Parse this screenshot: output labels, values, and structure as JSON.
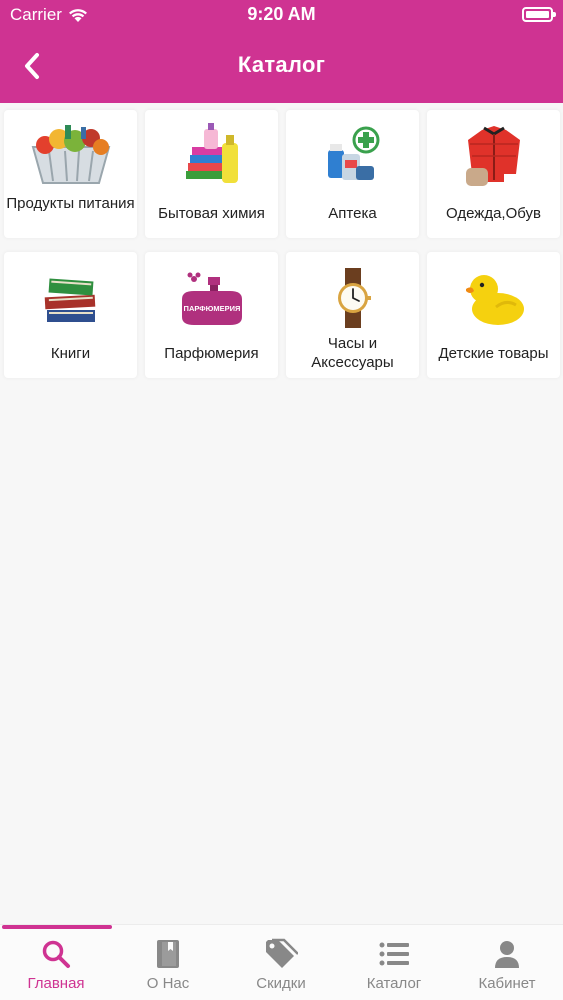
{
  "status_bar": {
    "carrier": "Carrier",
    "time": "9:20 AM"
  },
  "header": {
    "title": "Каталог"
  },
  "colors": {
    "brand": "#cf3392",
    "tab_inactive": "#888888"
  },
  "catalog": [
    {
      "label": "Продукты питания",
      "icon": "grocery-basket-icon"
    },
    {
      "label": "Бытовая химия",
      "icon": "detergent-icon"
    },
    {
      "label": "Аптека",
      "icon": "pharmacy-icon"
    },
    {
      "label": "Одежда,Обув",
      "icon": "clothing-icon"
    },
    {
      "label": "Книги",
      "icon": "books-icon"
    },
    {
      "label": "Парфюмерия",
      "icon": "perfume-icon",
      "icon_text": "ПАРФЮМЕРИЯ"
    },
    {
      "label": "Часы и Аксессуары",
      "icon": "watch-icon"
    },
    {
      "label": "Детские товары",
      "icon": "rubber-duck-icon"
    }
  ],
  "tabbar": [
    {
      "label": "Главная",
      "icon": "search-icon",
      "active": true
    },
    {
      "label": "О Нас",
      "icon": "book-icon",
      "active": false
    },
    {
      "label": "Скидки",
      "icon": "tag-icon",
      "active": false
    },
    {
      "label": "Каталог",
      "icon": "list-icon",
      "active": false
    },
    {
      "label": "Кабинет",
      "icon": "user-icon",
      "active": false
    }
  ]
}
